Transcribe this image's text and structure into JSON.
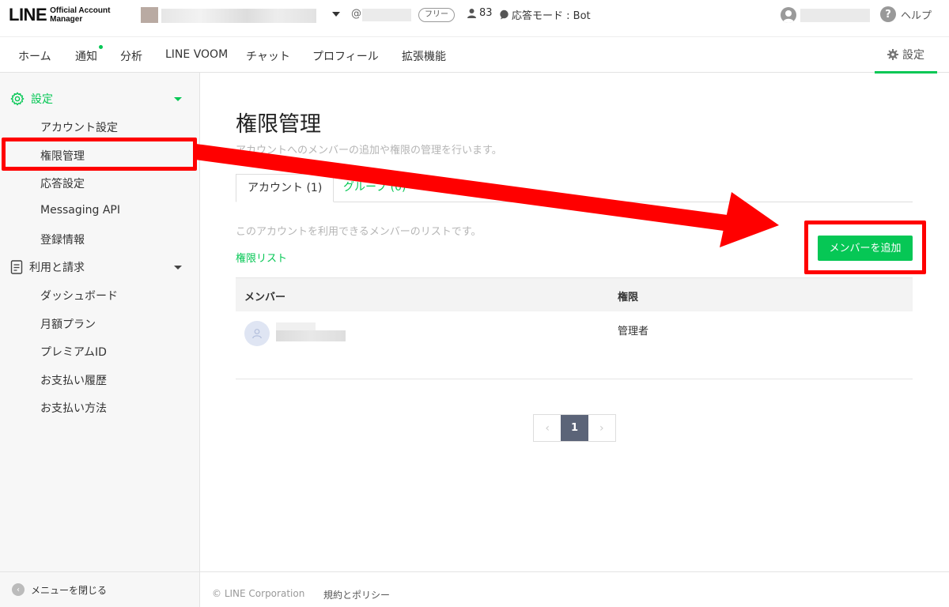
{
  "header": {
    "logo_main": "LINE",
    "logo_sub_1": "Official Account",
    "logo_sub_2": "Manager",
    "account_id_prefix": "@",
    "plan_badge": "フリー",
    "friends_count": "83",
    "response_mode": "応答モード : Bot",
    "help_icon_glyph": "?",
    "help_label": "ヘルプ"
  },
  "nav": {
    "items": [
      "ホーム",
      "通知",
      "分析",
      "LINE VOOM",
      "チャット",
      "プロフィール",
      "拡張機能"
    ],
    "settings_label": "設定"
  },
  "sidebar": {
    "section_settings": "設定",
    "settings_items": [
      "アカウント設定",
      "権限管理",
      "応答設定",
      "Messaging API",
      "登録情報"
    ],
    "section_billing": "利用と請求",
    "billing_items": [
      "ダッシュボード",
      "月額プラン",
      "プレミアムID",
      "お支払い履歴",
      "お支払い方法"
    ],
    "close_menu": "メニューを閉じる"
  },
  "main": {
    "title": "権限管理",
    "description": "アカウントへのメンバーの追加や権限の管理を行います。",
    "tabs": [
      {
        "label": "アカウント (1)"
      },
      {
        "label": "グループ (0)"
      }
    ],
    "list_description": "このアカウントを利用できるメンバーのリストです。",
    "permission_list_link": "権限リスト",
    "add_member_button": "メンバーを追加",
    "table": {
      "headers": [
        "メンバー",
        "権限"
      ],
      "rows": [
        {
          "role": "管理者"
        }
      ]
    },
    "pagination": {
      "prev": "‹",
      "current": "1",
      "next": "›"
    }
  },
  "footer": {
    "copyright": "© LINE Corporation",
    "policy": "規約とポリシー"
  },
  "colors": {
    "accent": "#06c755",
    "annotation": "#ff0000",
    "pager_active": "#5b6478"
  }
}
